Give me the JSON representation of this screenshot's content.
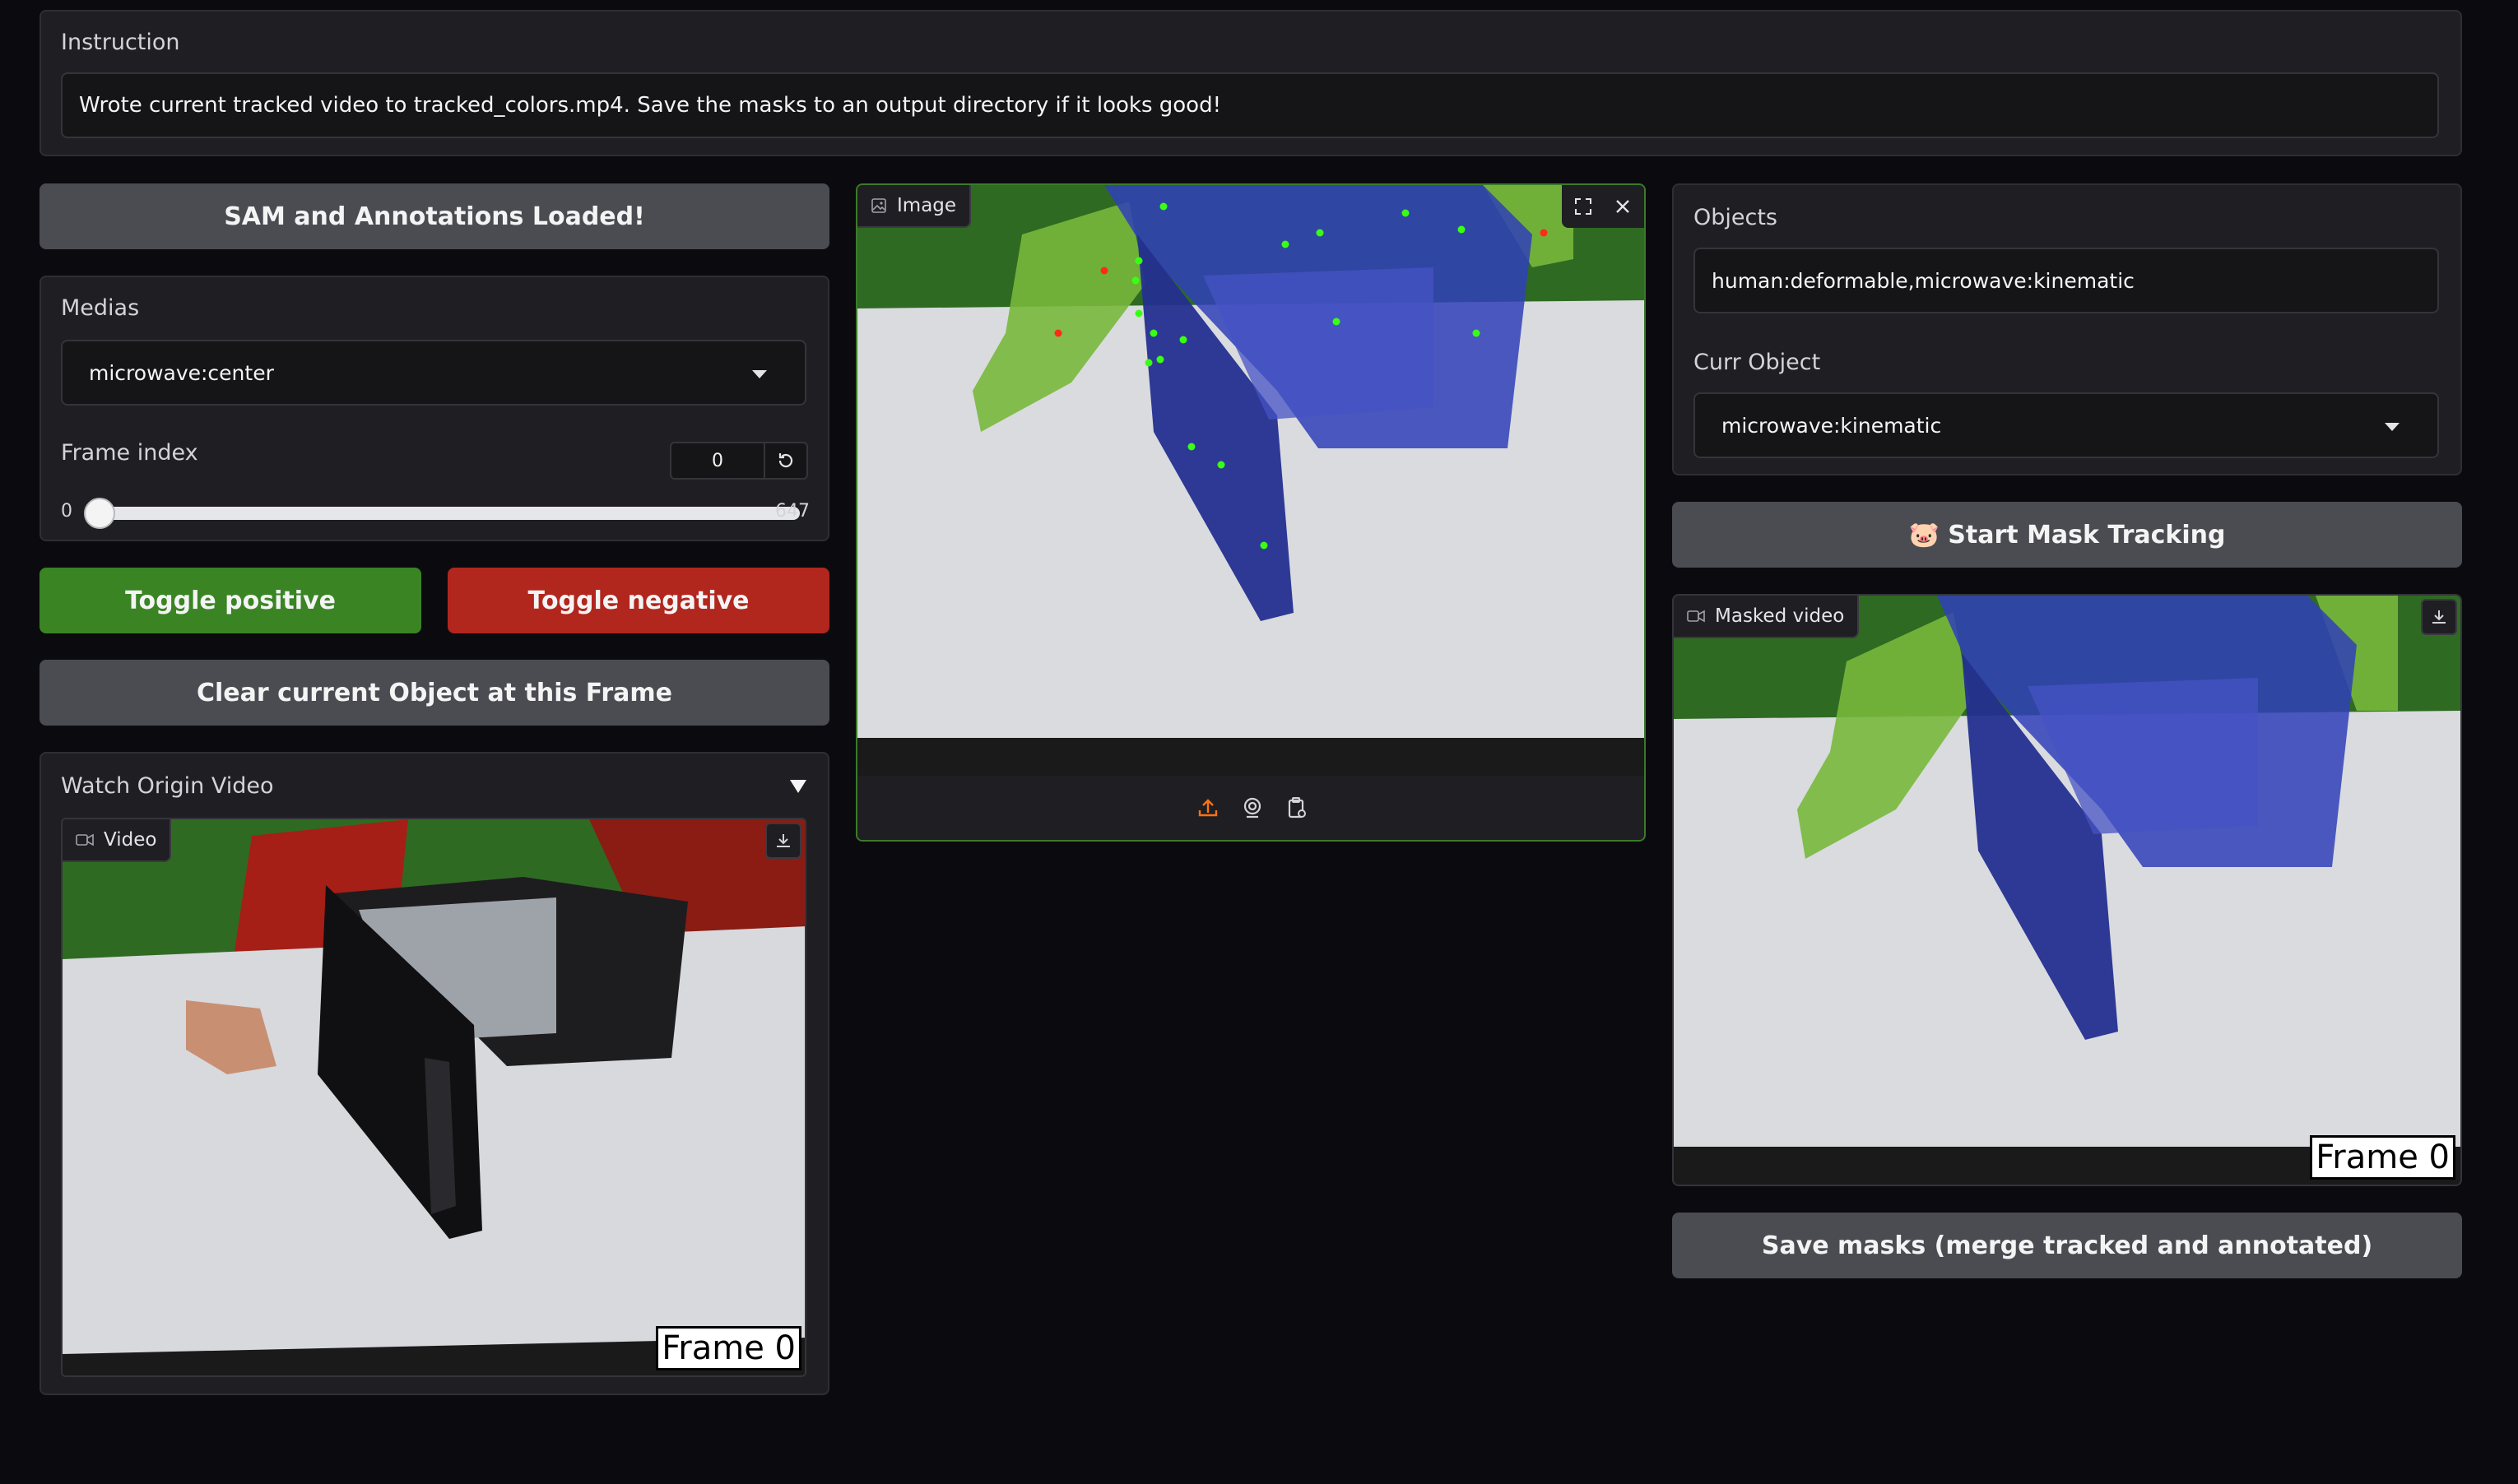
{
  "instruction": {
    "label": "Instruction",
    "text": "Wrote current tracked video to tracked_colors.mp4. Save the masks to an output directory if it looks good!"
  },
  "left": {
    "status_button": "SAM and Annotations Loaded!",
    "medias_label": "Medias",
    "medias_value": "microwave:center",
    "frame_index_label": "Frame index",
    "frame_index_value": "0",
    "slider_min": "0",
    "slider_max": "647",
    "slider_value_fraction": 0,
    "toggle_positive": "Toggle positive",
    "toggle_negative": "Toggle negative",
    "clear_button": "Clear current Object at this Frame",
    "watch_label": "Watch Origin Video",
    "video_tag": "Video",
    "video_frame": "Frame 0"
  },
  "center": {
    "image_tag": "Image"
  },
  "right": {
    "objects_label": "Objects",
    "objects_value": "human:deformable,microwave:kinematic",
    "curr_object_label": "Curr Object",
    "curr_object_value": "microwave:kinematic",
    "start_tracking": "🐷 Start Mask Tracking",
    "masked_video_tag": "Masked video",
    "masked_frame": "Frame 0",
    "save_masks": "Save masks (merge tracked and annotated)"
  },
  "colors": {
    "positive": "#3a8424",
    "negative": "#b1261d",
    "mask_blue": "#2f3fb8",
    "mask_green": "#78b83c",
    "accent_orange": "#f97316"
  }
}
